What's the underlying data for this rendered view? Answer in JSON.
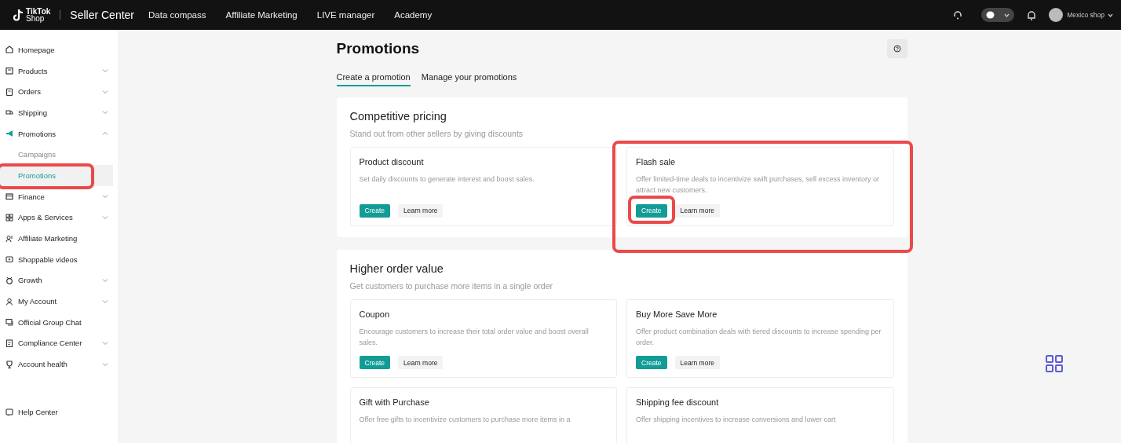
{
  "topbar": {
    "logo_line1": "TikTok",
    "logo_line2": "Shop",
    "product": "Seller Center",
    "nav": [
      "Data compass",
      "Affiliate Marketing",
      "LIVE manager",
      "Academy"
    ],
    "account": "Mexico shop"
  },
  "sidebar": {
    "items": [
      {
        "label": "Homepage",
        "kind": "link"
      },
      {
        "label": "Products",
        "kind": "group",
        "expanded": false
      },
      {
        "label": "Orders",
        "kind": "group",
        "expanded": false
      },
      {
        "label": "Shipping",
        "kind": "group",
        "expanded": false
      },
      {
        "label": "Promotions",
        "kind": "group",
        "expanded": true,
        "children": [
          {
            "label": "Campaigns",
            "selected": false,
            "highlighted": false
          },
          {
            "label": "Promotions",
            "selected": true,
            "highlighted": true
          }
        ]
      },
      {
        "label": "Finance",
        "kind": "group",
        "expanded": false
      },
      {
        "label": "Apps & Services",
        "kind": "group",
        "expanded": false
      },
      {
        "label": "Affiliate Marketing",
        "kind": "link"
      },
      {
        "label": "Shoppable videos",
        "kind": "link"
      },
      {
        "label": "Growth",
        "kind": "group",
        "expanded": false
      },
      {
        "label": "My Account",
        "kind": "group",
        "expanded": false
      },
      {
        "label": "Official Group Chat",
        "kind": "link"
      },
      {
        "label": "Compliance Center",
        "kind": "group",
        "expanded": false
      },
      {
        "label": "Account health",
        "kind": "group",
        "expanded": false
      }
    ],
    "footer_item": "Help Center"
  },
  "page": {
    "title": "Promotions",
    "tabs": [
      {
        "label": "Create a promotion",
        "selected": true
      },
      {
        "label": "Manage your promotions",
        "selected": false
      }
    ],
    "sections": [
      {
        "title": "Competitive pricing",
        "subtitle": "Stand out from other sellers by giving discounts",
        "cards": [
          {
            "title": "Product discount",
            "description": "Set daily discounts to generate interest and boost sales.",
            "highlighted": false,
            "buttons": [
              {
                "label": "Create",
                "kind": "primary",
                "highlighted": false
              },
              {
                "label": "Learn more",
                "kind": "secondary",
                "highlighted": false
              }
            ]
          },
          {
            "title": "Flash sale",
            "description": "Offer limited-time deals to incentivize swift purchases, sell excess inventory or attract new customers.",
            "highlighted": true,
            "buttons": [
              {
                "label": "Create",
                "kind": "primary",
                "highlighted": true
              },
              {
                "label": "Learn more",
                "kind": "secondary",
                "highlighted": false
              }
            ]
          }
        ]
      },
      {
        "title": "Higher order value",
        "subtitle": "Get customers to purchase more items in a single order",
        "cards": [
          {
            "title": "Coupon",
            "description": "Encourage customers to increase their total order value and boost overall sales.",
            "highlighted": false,
            "buttons": [
              {
                "label": "Create",
                "kind": "primary",
                "highlighted": false
              },
              {
                "label": "Learn more",
                "kind": "secondary",
                "highlighted": false
              }
            ]
          },
          {
            "title": "Buy More Save More",
            "description": "Offer product combination deals with tiered discounts to increase spending per order.",
            "highlighted": false,
            "buttons": [
              {
                "label": "Create",
                "kind": "primary",
                "highlighted": false
              },
              {
                "label": "Learn more",
                "kind": "secondary",
                "highlighted": false
              }
            ]
          },
          {
            "title": "Gift with Purchase",
            "description": "Offer free gifts to incentivize customers to purchase more items in a",
            "highlighted": false
          },
          {
            "title": "Shipping fee discount",
            "description": "Offer shipping incentives to increase conversions and lower cart",
            "highlighted": false
          }
        ]
      }
    ]
  }
}
